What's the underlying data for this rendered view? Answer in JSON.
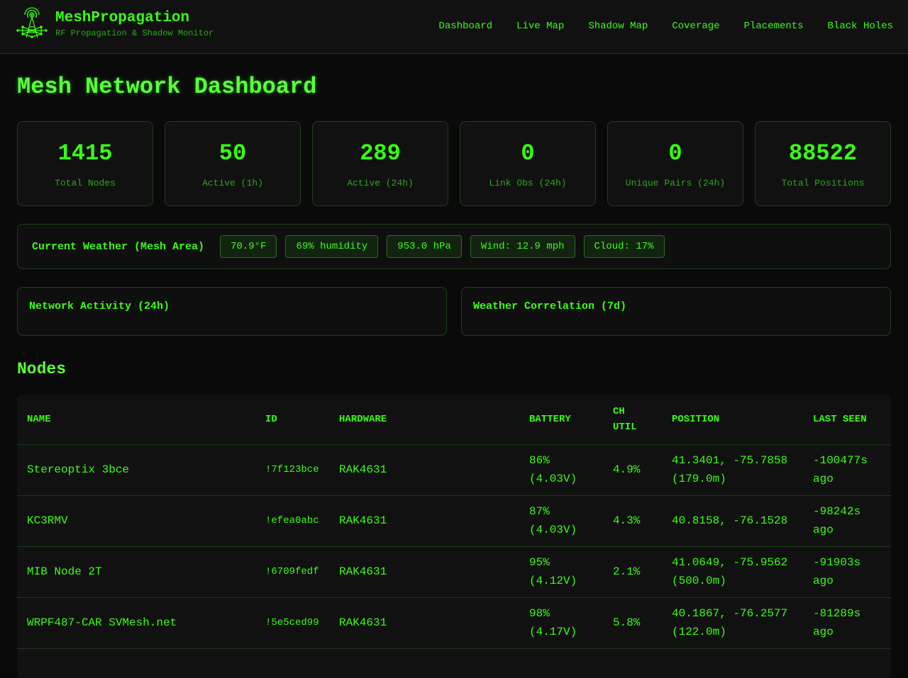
{
  "brand": {
    "name": "MeshPropagation",
    "subtitle": "RF Propagation & Shadow Monitor",
    "logo_icon": "radio-tower-mesh-icon"
  },
  "nav": [
    "Dashboard",
    "Live Map",
    "Shadow Map",
    "Coverage",
    "Placements",
    "Black Holes"
  ],
  "page_title": "Mesh Network Dashboard",
  "stats": [
    {
      "value": "1415",
      "label": "Total Nodes"
    },
    {
      "value": "50",
      "label": "Active (1h)"
    },
    {
      "value": "289",
      "label": "Active (24h)"
    },
    {
      "value": "0",
      "label": "Link Obs (24h)"
    },
    {
      "value": "0",
      "label": "Unique Pairs (24h)"
    },
    {
      "value": "88522",
      "label": "Total Positions"
    }
  ],
  "weather": {
    "title": "Current Weather (Mesh Area)",
    "chips": [
      "70.9°F",
      "69% humidity",
      "953.0 hPa",
      "Wind: 12.9 mph",
      "Cloud: 17%"
    ]
  },
  "panels": {
    "activity_title": "Network Activity (24h)",
    "weather_corr_title": "Weather Correlation (7d)"
  },
  "nodes_title": "Nodes",
  "table": {
    "headers": [
      "NAME",
      "ID",
      "HARDWARE",
      "BATTERY",
      "CH UTIL",
      "POSITION",
      "LAST SEEN"
    ],
    "rows": [
      {
        "name": "Stereoptix 3bce",
        "id": "!7f123bce",
        "hardware": "RAK4631",
        "battery": "86% (4.03V)",
        "ch_util": "4.9%",
        "position": "41.3401, -75.7858 (179.0m)",
        "last_seen": "-100477s ago"
      },
      {
        "name": "KC3RMV",
        "id": "!efea0abc",
        "hardware": "RAK4631",
        "battery": "87% (4.03V)",
        "ch_util": "4.3%",
        "position": "40.8158, -76.1528",
        "last_seen": "-98242s ago"
      },
      {
        "name": "MIB Node 2T",
        "id": "!6709fedf",
        "hardware": "RAK4631",
        "battery": "95% (4.12V)",
        "ch_util": "2.1%",
        "position": "41.0649, -75.9562 (500.0m)",
        "last_seen": "-91903s ago"
      },
      {
        "name": "WRPF487-CAR SVMesh.net",
        "id": "!5e5ced99",
        "hardware": "RAK4631",
        "battery": "98% (4.17V)",
        "ch_util": "5.8%",
        "position": "40.1867, -76.2577 (122.0m)",
        "last_seen": "-81289s ago"
      }
    ]
  },
  "colors": {
    "background": "#0a0a0a",
    "surface": "#111111",
    "accent": "#39ff14",
    "muted": "#2aa81a",
    "border": "#1e3f1b"
  }
}
